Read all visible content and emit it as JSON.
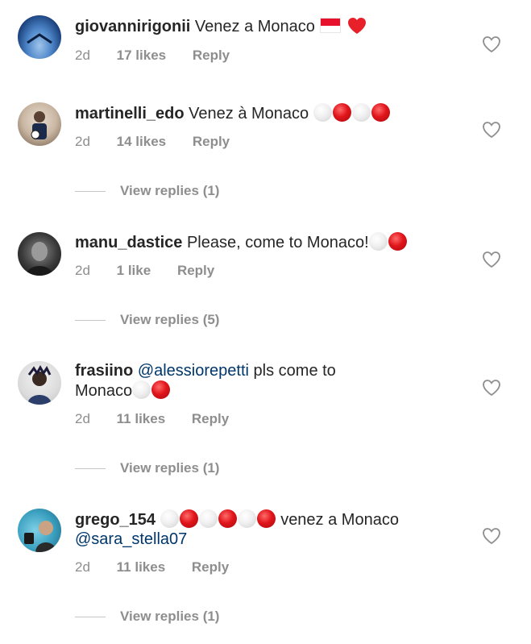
{
  "comments": [
    {
      "username": "giovannirigonii",
      "text": "Venez a Monaco",
      "time": "2d",
      "likes": "17 likes",
      "reply": "Reply"
    },
    {
      "username": "martinelli_edo",
      "text": "Venez à Monaco",
      "time": "2d",
      "likes": "14 likes",
      "reply": "Reply",
      "view_replies": "View replies (1)"
    },
    {
      "username": "manu_dastice",
      "text": "Please, come to Monaco!",
      "time": "2d",
      "likes": "1 like",
      "reply": "Reply",
      "view_replies": "View replies (5)"
    },
    {
      "username": "frasiino",
      "mention": "@alessiorepetti",
      "text": "pls come to",
      "text2": "Monaco",
      "time": "2d",
      "likes": "11 likes",
      "reply": "Reply",
      "view_replies": "View replies (1)"
    },
    {
      "username": "grego_154",
      "text": "venez a Monaco",
      "mention": "@sara_stella07",
      "time": "2d",
      "likes": "11 likes",
      "reply": "Reply",
      "view_replies": "View replies (1)"
    }
  ],
  "icons": {
    "like": "heart-outline-icon",
    "flag": "monaco-flag-emoji",
    "red_heart": "red-heart-emoji",
    "white_circle": "white-circle-emoji",
    "red_circle": "red-circle-emoji"
  },
  "colors": {
    "text": "#262626",
    "meta": "#8e8e8e",
    "mention": "#00376b",
    "red": "#e0151b"
  }
}
